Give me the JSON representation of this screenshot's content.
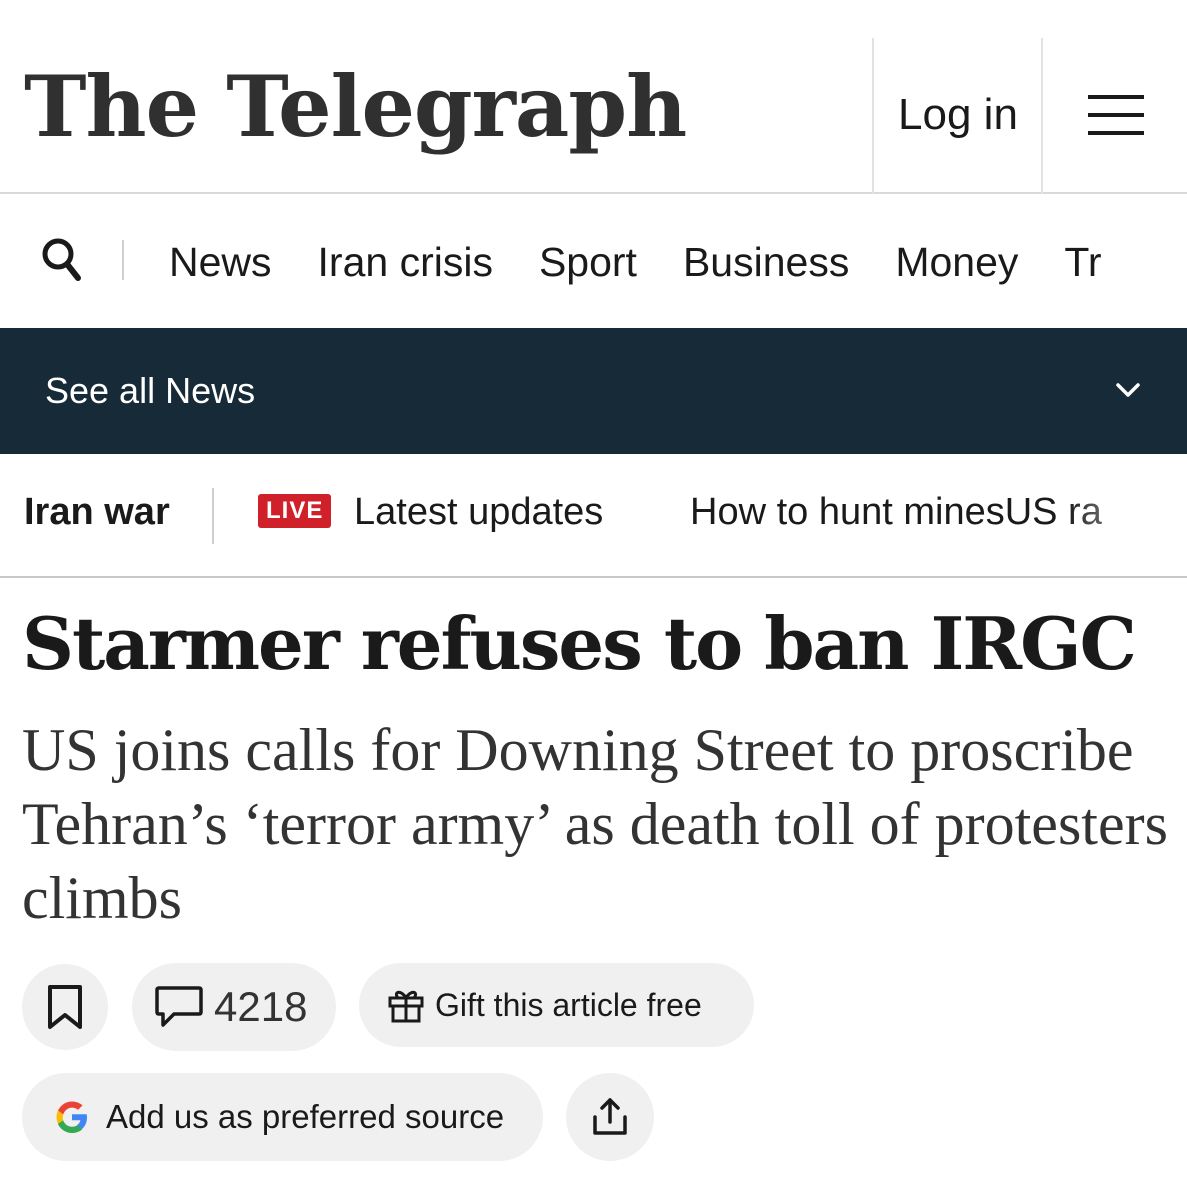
{
  "header": {
    "logo_text": "The Telegraph",
    "login_label": "Log in",
    "menu_icon": "hamburger-menu-icon"
  },
  "nav": {
    "search_icon": "search-icon",
    "links": [
      "News",
      "Iran crisis",
      "Sport",
      "Business",
      "Money",
      "Tr"
    ]
  },
  "see_all": {
    "label": "See all News",
    "chevron_icon": "chevron-down-icon",
    "bg_color": "#162a38"
  },
  "topic_strip": {
    "title": "Iran war",
    "live_badge": "LIVE",
    "live_color": "#d0202a",
    "items": [
      "Latest updates",
      "How to hunt minesUS ra"
    ]
  },
  "article": {
    "headline": "Starmer refuses to ban IRGC",
    "standfirst": "US joins calls for Downing Street to proscribe Tehran’s ‘terror army’ as death toll of protesters climbs"
  },
  "actions": {
    "bookmark_icon": "bookmark-icon",
    "comment_icon": "comment-icon",
    "comment_count": "4218",
    "gift_icon": "gift-icon",
    "gift_label": "Gift this article free",
    "google_icon": "google-icon",
    "preferred_source_label": "Add us as preferred source",
    "share_icon": "share-icon"
  }
}
